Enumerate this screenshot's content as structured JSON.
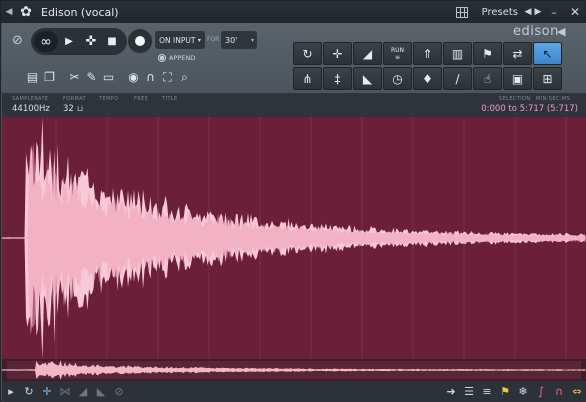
{
  "titlebar": {
    "title": "Edison (vocal)",
    "presets_label": "Presets",
    "arrow_icon": "triangle-right",
    "gear_icon": "gear",
    "prev_icon": "triangle-left",
    "next_icon": "triangle-right",
    "minimize_icon": "minimize",
    "close_icon": "close"
  },
  "logo": {
    "text": "edison"
  },
  "record": {
    "mode": "ON INPUT",
    "for_label": "FOR",
    "duration": "30'",
    "append_label": "APPEND"
  },
  "toolgrid": {
    "row1": [
      {
        "name": "rotate",
        "glyph": "↻"
      },
      {
        "name": "crosshair",
        "glyph": "✛"
      },
      {
        "name": "ramp",
        "glyph": "◢"
      },
      {
        "name": "run",
        "glyph": "RUN\n≡"
      },
      {
        "name": "rocket",
        "glyph": "⇑"
      },
      {
        "name": "spectrum",
        "glyph": "▮"
      },
      {
        "name": "marker-plus",
        "glyph": "⚑"
      },
      {
        "name": "swap",
        "glyph": "⇄"
      },
      {
        "name": "drag-cursor",
        "glyph": "↖"
      }
    ],
    "row2": [
      {
        "name": "scissors",
        "glyph": "⋔"
      },
      {
        "name": "vertical-lines",
        "glyph": "‡"
      },
      {
        "name": "decay",
        "glyph": "◣"
      },
      {
        "name": "clock",
        "glyph": "◷"
      },
      {
        "name": "drop",
        "glyph": "♦"
      },
      {
        "name": "leaf",
        "glyph": "∕"
      },
      {
        "name": "hand",
        "glyph": "☝"
      },
      {
        "name": "save-disk",
        "glyph": "▣"
      },
      {
        "name": "export",
        "glyph": "⊞"
      }
    ]
  },
  "info": {
    "samplerate_label": "SAMPLERATE",
    "samplerate": "44100Hz",
    "format_label": "FORMAT",
    "format": "32",
    "tempo_label": "TEMPO",
    "free_label": "FREE",
    "title_label": "TITLE",
    "selection_label": "SELECTION",
    "units_label": "MIN:SEC:MS",
    "selection": "0:000 to 5:717 (5:717)"
  },
  "colors": {
    "wave_bg": "#6b1f38",
    "wave_fill": "#f7c8d6",
    "ovw_fill": "#f2b6c8",
    "accent": "#4a96db"
  }
}
